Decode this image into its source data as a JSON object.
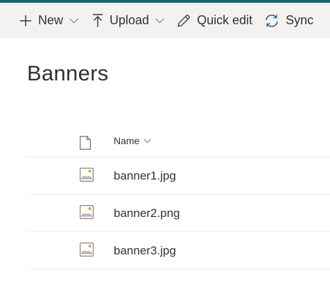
{
  "toolbar": {
    "new_label": "New",
    "upload_label": "Upload",
    "quick_edit_label": "Quick edit",
    "sync_label": "Sync"
  },
  "page": {
    "title": "Banners"
  },
  "list": {
    "columns": {
      "name": "Name"
    },
    "items": [
      {
        "name": "banner1.jpg",
        "icon": "image-file-icon"
      },
      {
        "name": "banner2.png",
        "icon": "image-file-icon"
      },
      {
        "name": "banner3.jpg",
        "icon": "image-file-icon"
      }
    ]
  },
  "colors": {
    "accent_strip": "#0b6a78",
    "command_bar_bg": "#f3f2f1",
    "sync_icon": "#0078d4",
    "image_icon_sun": "#f2a100"
  }
}
